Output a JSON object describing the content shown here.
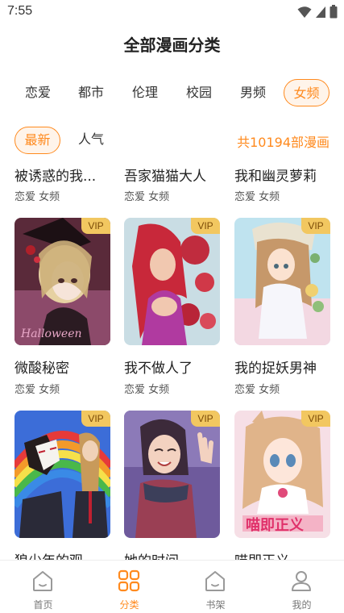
{
  "status_bar": {
    "time": "7:55",
    "icons": [
      "wifi-icon",
      "signal-icon",
      "battery-icon"
    ]
  },
  "page_title": "全部漫画分类",
  "category_tabs": [
    {
      "label": "恋爱",
      "active": false
    },
    {
      "label": "都市",
      "active": false
    },
    {
      "label": "伦理",
      "active": false
    },
    {
      "label": "校园",
      "active": false
    },
    {
      "label": "男频",
      "active": false
    },
    {
      "label": "女频",
      "active": true
    }
  ],
  "sort": {
    "options": [
      {
        "label": "最新",
        "active": true
      },
      {
        "label": "人气",
        "active": false
      }
    ],
    "total": "共10194部漫画"
  },
  "comics": [
    {
      "title": "被诱惑的我...",
      "tags": "恋爱 女频"
    },
    {
      "title": "吾家猫猫大人",
      "tags": "恋爱 女频"
    },
    {
      "title": "我和幽灵萝莉",
      "tags": "恋爱 女频"
    },
    {
      "title": "微酸秘密",
      "tags": "恋爱 女频",
      "vip": "VIP"
    },
    {
      "title": "我不做人了",
      "tags": "恋爱 女频",
      "vip": "VIP"
    },
    {
      "title": "我的捉妖男神",
      "tags": "恋爱 女频",
      "vip": "VIP"
    },
    {
      "title": "狼少年的观",
      "vip": "VIP"
    },
    {
      "title": "她的时间",
      "vip": "VIP"
    },
    {
      "title": "喵即正义",
      "vip": "VIP"
    }
  ],
  "bottom_nav": [
    {
      "label": "首页",
      "icon": "home-icon",
      "active": false
    },
    {
      "label": "分类",
      "icon": "category-grid-icon",
      "active": true
    },
    {
      "label": "书架",
      "icon": "bookshelf-icon",
      "active": false
    },
    {
      "label": "我的",
      "icon": "profile-icon",
      "active": false
    }
  ],
  "colors": {
    "accent": "#ff8a1e",
    "vip_badge": "#f2c760"
  }
}
